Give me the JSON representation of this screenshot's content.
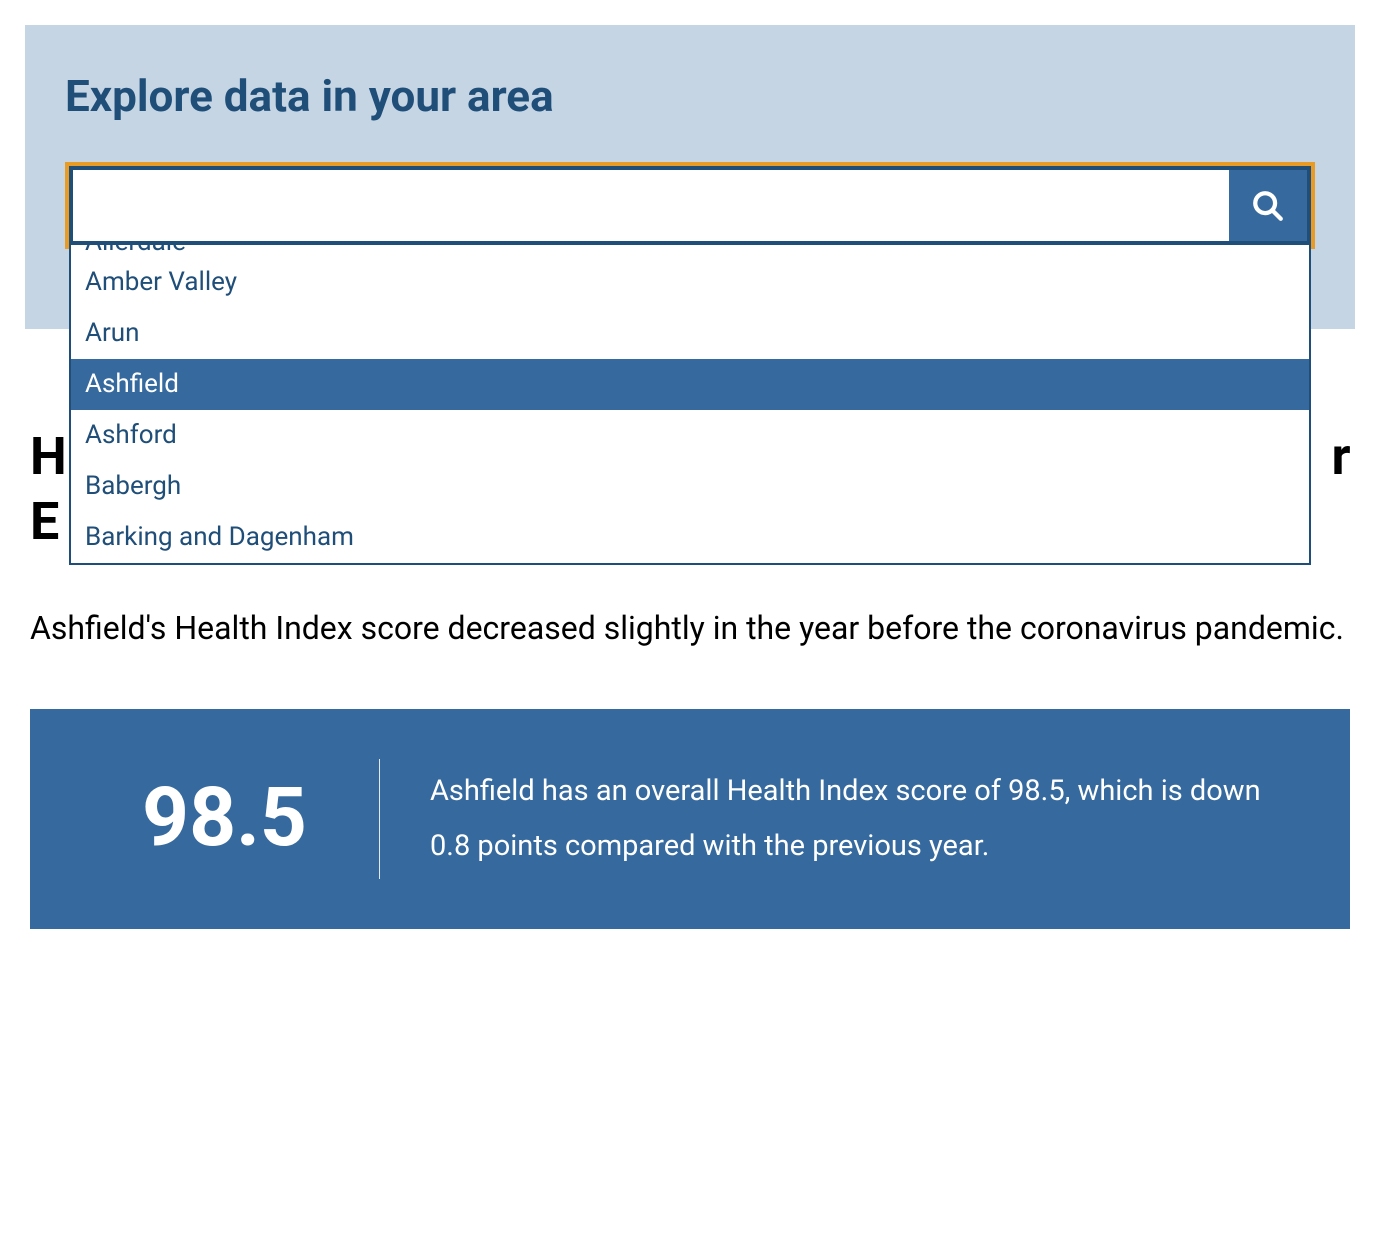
{
  "search": {
    "title": "Explore data in your area",
    "input_value": "",
    "placeholder": "",
    "cut_item": "Allerdale",
    "options": [
      {
        "label": "Amber Valley",
        "selected": false
      },
      {
        "label": "Arun",
        "selected": false
      },
      {
        "label": "Ashfield",
        "selected": true
      },
      {
        "label": "Ashford",
        "selected": false
      },
      {
        "label": "Babergh",
        "selected": false
      },
      {
        "label": "Barking and Dagenham",
        "selected": false
      }
    ]
  },
  "heading_prefix": "H",
  "heading_suffix": "r",
  "heading_line2_prefix": "E",
  "summary": "Ashfield's Health Index score decreased slightly in the year before the coronavirus pandemic.",
  "scorecard": {
    "value": "98.5",
    "description": "Ashfield has an overall Health Index score of 98.5, which is down 0.8 points compared with the previous year."
  }
}
